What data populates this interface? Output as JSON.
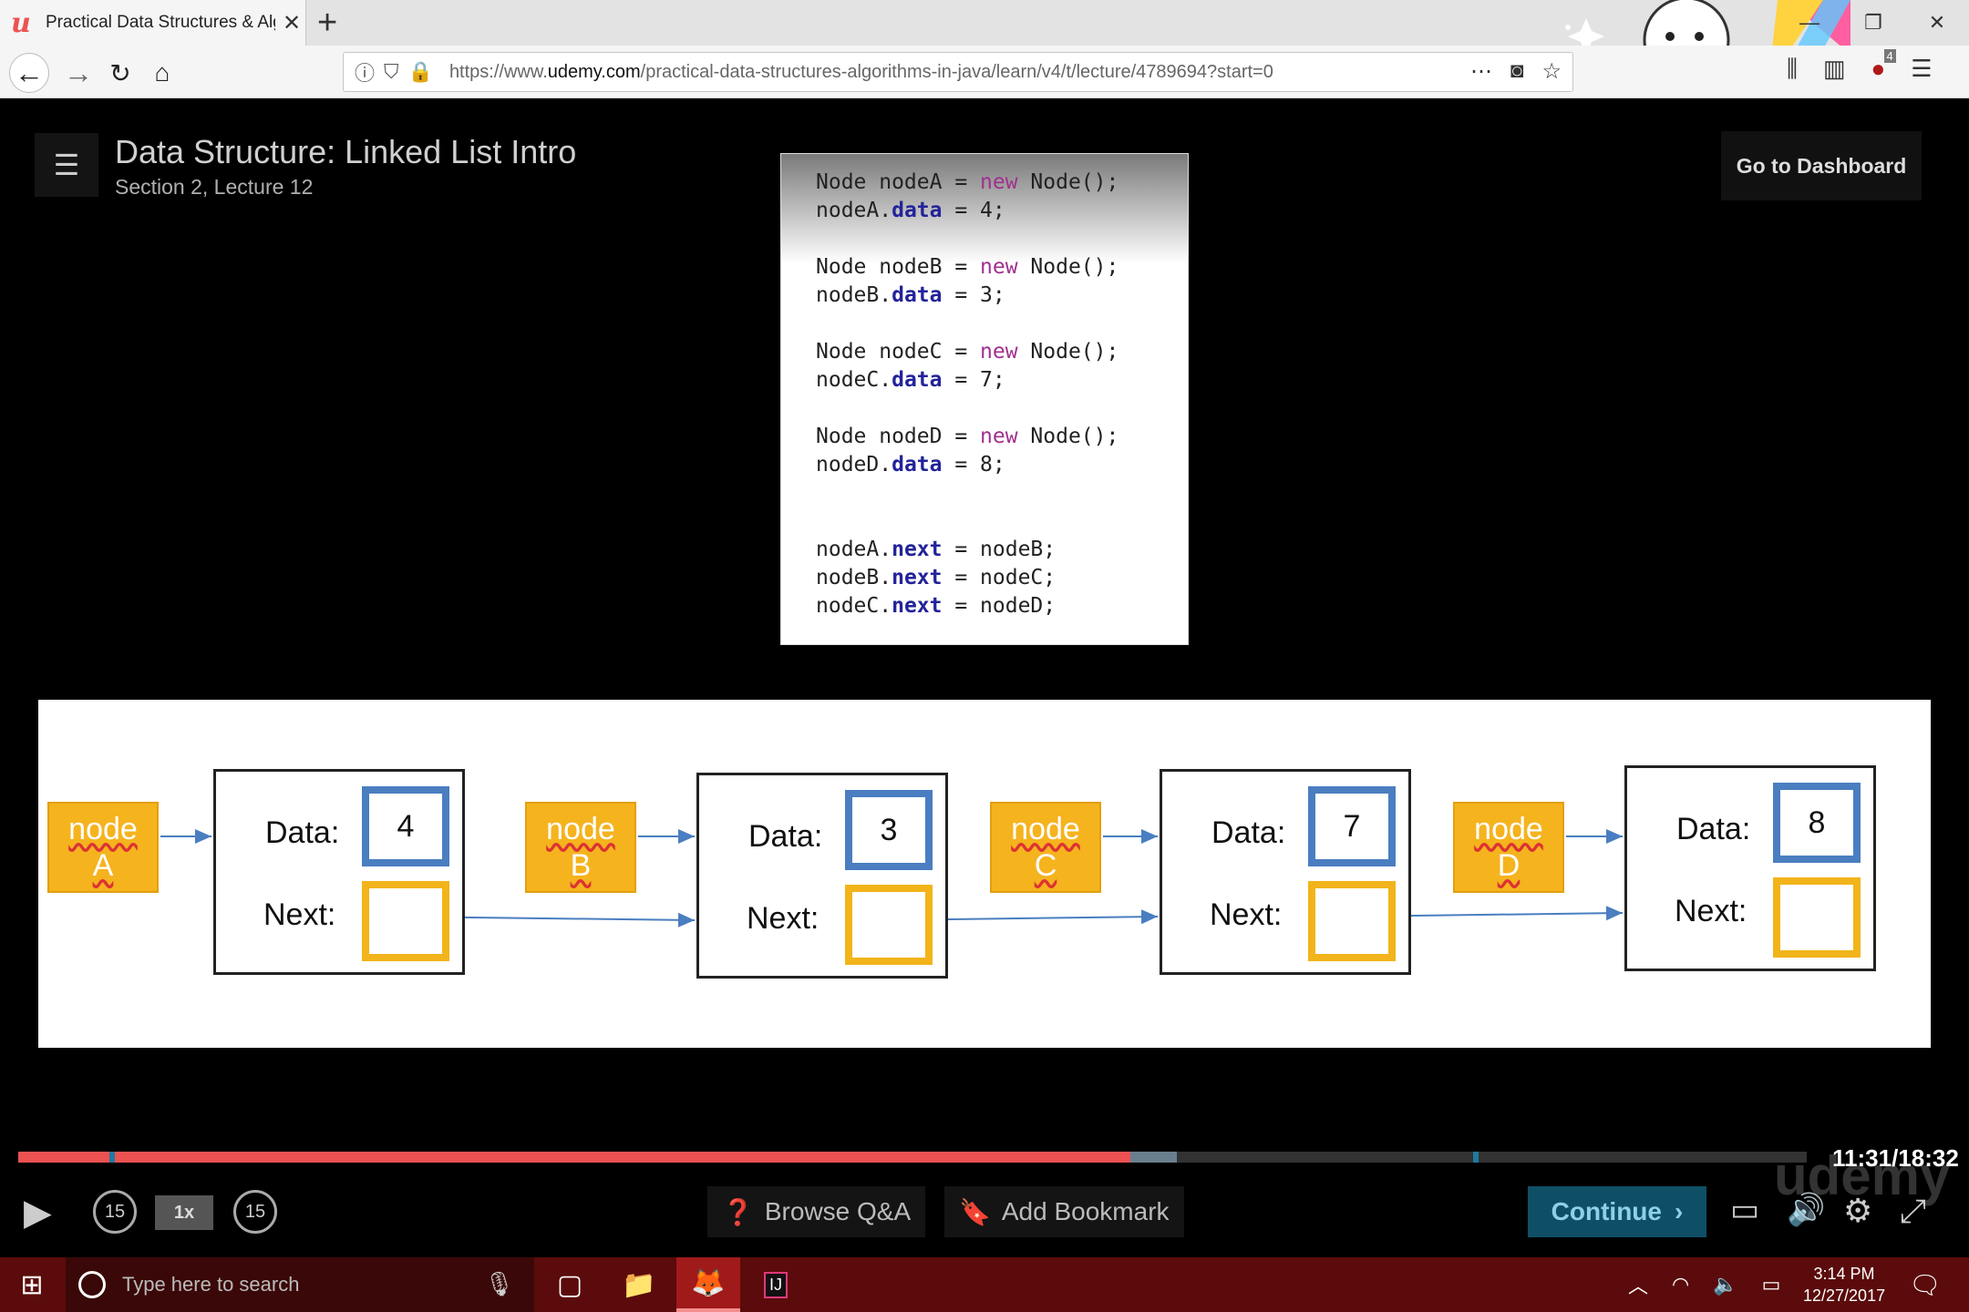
{
  "browser": {
    "tab_title": "Practical Data Structures & Alg",
    "url_prefix": "https://www.",
    "url_host": "udemy.com",
    "url_path": "/practical-data-structures-algorithms-in-java/learn/v4/t/lecture/4789694?start=0",
    "addon_badge": "4"
  },
  "lecture": {
    "title": "Data Structure: Linked List Intro",
    "subtitle": "Section 2, Lecture 12",
    "dashboard_label": "Go to Dashboard"
  },
  "code_slide": {
    "lines": [
      "Node nodeA = new Node();",
      "nodeA.data = 4;",
      "",
      "Node nodeB = new Node();",
      "nodeB.data = 3;",
      "",
      "Node nodeC = new Node();",
      "nodeC.data = 7;",
      "",
      "Node nodeD = new Node();",
      "nodeD.data = 8;",
      "",
      "",
      "nodeA.next = nodeB;",
      "nodeB.next = nodeC;",
      "nodeC.next = nodeD;"
    ]
  },
  "diagram": {
    "data_label": "Data:",
    "next_label": "Next:",
    "node_word": "node",
    "nodes": [
      {
        "label": "A",
        "data": "4"
      },
      {
        "label": "B",
        "data": "3"
      },
      {
        "label": "C",
        "data": "7"
      },
      {
        "label": "D",
        "data": "8"
      }
    ]
  },
  "player": {
    "time": "11:31/18:32",
    "progress_fraction": 0.622,
    "buffered_fraction": 0.648,
    "skip_seconds": "15",
    "speed": "1x",
    "browse_qa": "Browse Q&A",
    "add_bookmark": "Add Bookmark",
    "continue": "Continue",
    "watermark": "udemy",
    "accent_color": "#ec5252"
  },
  "taskbar": {
    "search_placeholder": "Type here to search",
    "time": "3:14 PM",
    "date": "12/27/2017"
  }
}
